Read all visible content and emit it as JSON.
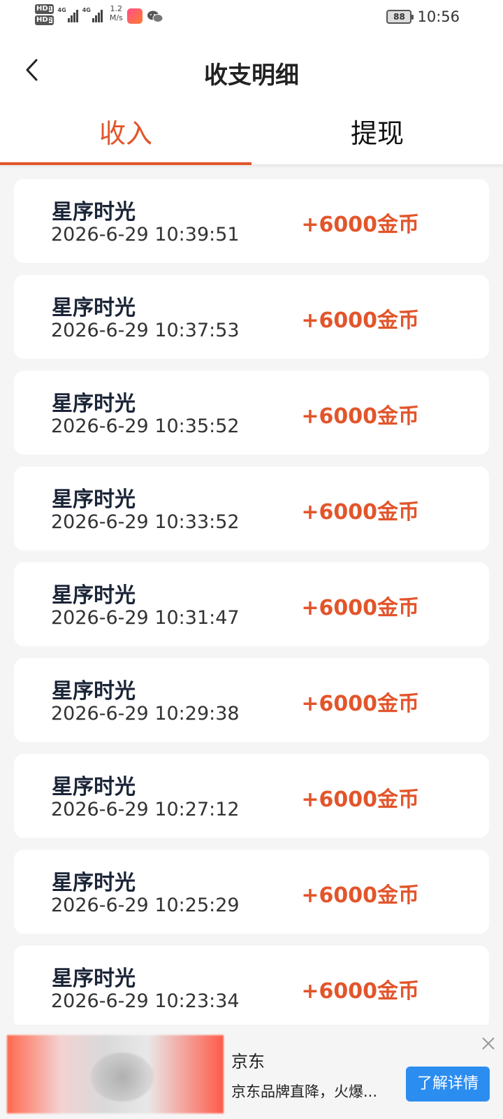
{
  "status_bar": {
    "hd1": "HD",
    "hd1_sub": "1",
    "hd2": "HD",
    "hd2_sub": "2",
    "net1": "4G",
    "net2": "4G",
    "speed_value": "1.2",
    "speed_unit": "M/s",
    "battery": "88",
    "time": "10:56",
    "icons": [
      "signal-icon",
      "app-notification-icon",
      "wechat-icon",
      "battery-icon"
    ]
  },
  "header": {
    "title": "收支明细",
    "back_icon": "chevron-left-icon"
  },
  "tabs": [
    {
      "label": "收入",
      "active": true
    },
    {
      "label": "提现",
      "active": false
    }
  ],
  "accent_color": "#e2552b",
  "records": [
    {
      "title": "星序时光",
      "time": "2026-6-29 10:39:51",
      "amount": "+6000金币"
    },
    {
      "title": "星序时光",
      "time": "2026-6-29 10:37:53",
      "amount": "+6000金币"
    },
    {
      "title": "星序时光",
      "time": "2026-6-29 10:35:52",
      "amount": "+6000金币"
    },
    {
      "title": "星序时光",
      "time": "2026-6-29 10:33:52",
      "amount": "+6000金币"
    },
    {
      "title": "星序时光",
      "time": "2026-6-29 10:31:47",
      "amount": "+6000金币"
    },
    {
      "title": "星序时光",
      "time": "2026-6-29 10:29:38",
      "amount": "+6000金币"
    },
    {
      "title": "星序时光",
      "time": "2026-6-29 10:27:12",
      "amount": "+6000金币"
    },
    {
      "title": "星序时光",
      "time": "2026-6-29 10:25:29",
      "amount": "+6000金币"
    },
    {
      "title": "星序时光",
      "time": "2026-6-29 10:23:34",
      "amount": "+6000金币"
    }
  ],
  "ad": {
    "brand": "京东",
    "description": "京东品牌直降，火爆...",
    "button_label": "了解详情",
    "button_color": "#2c8df0",
    "close_icon": "close-icon"
  }
}
